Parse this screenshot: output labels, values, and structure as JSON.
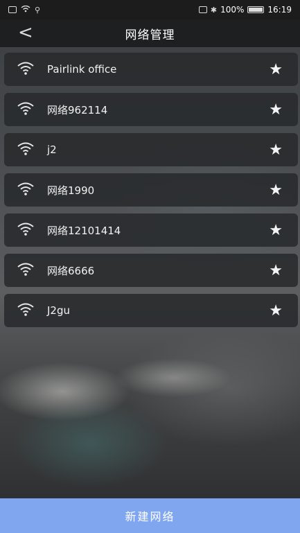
{
  "status_bar": {
    "battery": "100%",
    "time": "16:19"
  },
  "header": {
    "back_glyph": "<",
    "title": "网络管理"
  },
  "networks": [
    {
      "ssid": "Pairlink office",
      "star": "★"
    },
    {
      "ssid": "网络962114",
      "star": "★"
    },
    {
      "ssid": "j2",
      "star": "★"
    },
    {
      "ssid": "网络1990",
      "star": "★"
    },
    {
      "ssid": "网络12101414",
      "star": "★"
    },
    {
      "ssid": "网络6666",
      "star": "★"
    },
    {
      "ssid": "J2gu",
      "star": "★"
    }
  ],
  "footer": {
    "new_network_label": "新建网络"
  }
}
